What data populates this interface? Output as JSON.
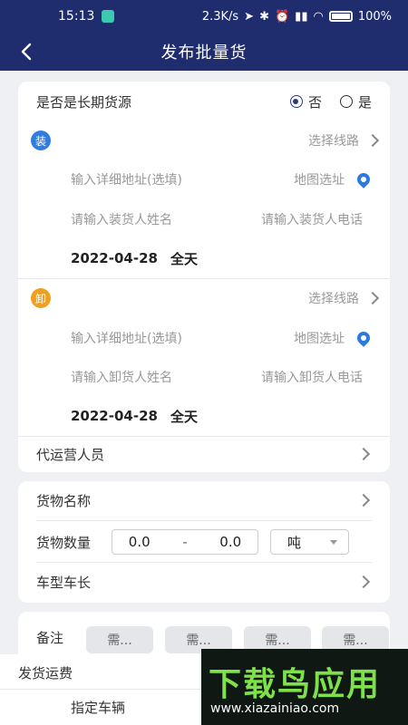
{
  "status_bar": {
    "time": "15:13",
    "speed": "2.3K/s",
    "battery": "100%"
  },
  "nav": {
    "title": "发布批量货"
  },
  "route": {
    "long_term": {
      "label": "是否是长期货源",
      "options": [
        "否",
        "是"
      ],
      "selected": "否"
    },
    "load": {
      "badge": "装",
      "badge_color": "#2f7de1",
      "select_route": "选择线路",
      "address_placeholder": "输入详细地址(选填)",
      "map_select": "地图选址",
      "name_placeholder": "请输入装货人姓名",
      "phone_placeholder": "请输入装货人电话",
      "date": "2022-04-28",
      "time": "全天"
    },
    "unload": {
      "badge": "卸",
      "badge_color": "#f0a020",
      "select_route": "选择线路",
      "address_placeholder": "输入详细地址(选填)",
      "map_select": "地图选址",
      "name_placeholder": "请输入卸货人姓名",
      "phone_placeholder": "请输入卸货人电话",
      "date": "2022-04-28",
      "time": "全天"
    },
    "operator_label": "代运营人员"
  },
  "goods": {
    "name_label": "货物名称",
    "qty_label": "货物数量",
    "qty_min": "0.0",
    "qty_sep": "-",
    "qty_max": "0.0",
    "unit": "吨",
    "vehicle_label": "车型车长"
  },
  "remarks": {
    "label": "备注",
    "chips": [
      "需...",
      "需...",
      "需...",
      "需..."
    ]
  },
  "bottom": {
    "freight_label": "发货运费",
    "vehicle_label": "指定车辆"
  },
  "watermark": {
    "title": "下载鸟应用",
    "url": "www.xiazainiao.com"
  },
  "colors": {
    "primary": "#1f2d6e",
    "pin": "#2b7ae0"
  }
}
